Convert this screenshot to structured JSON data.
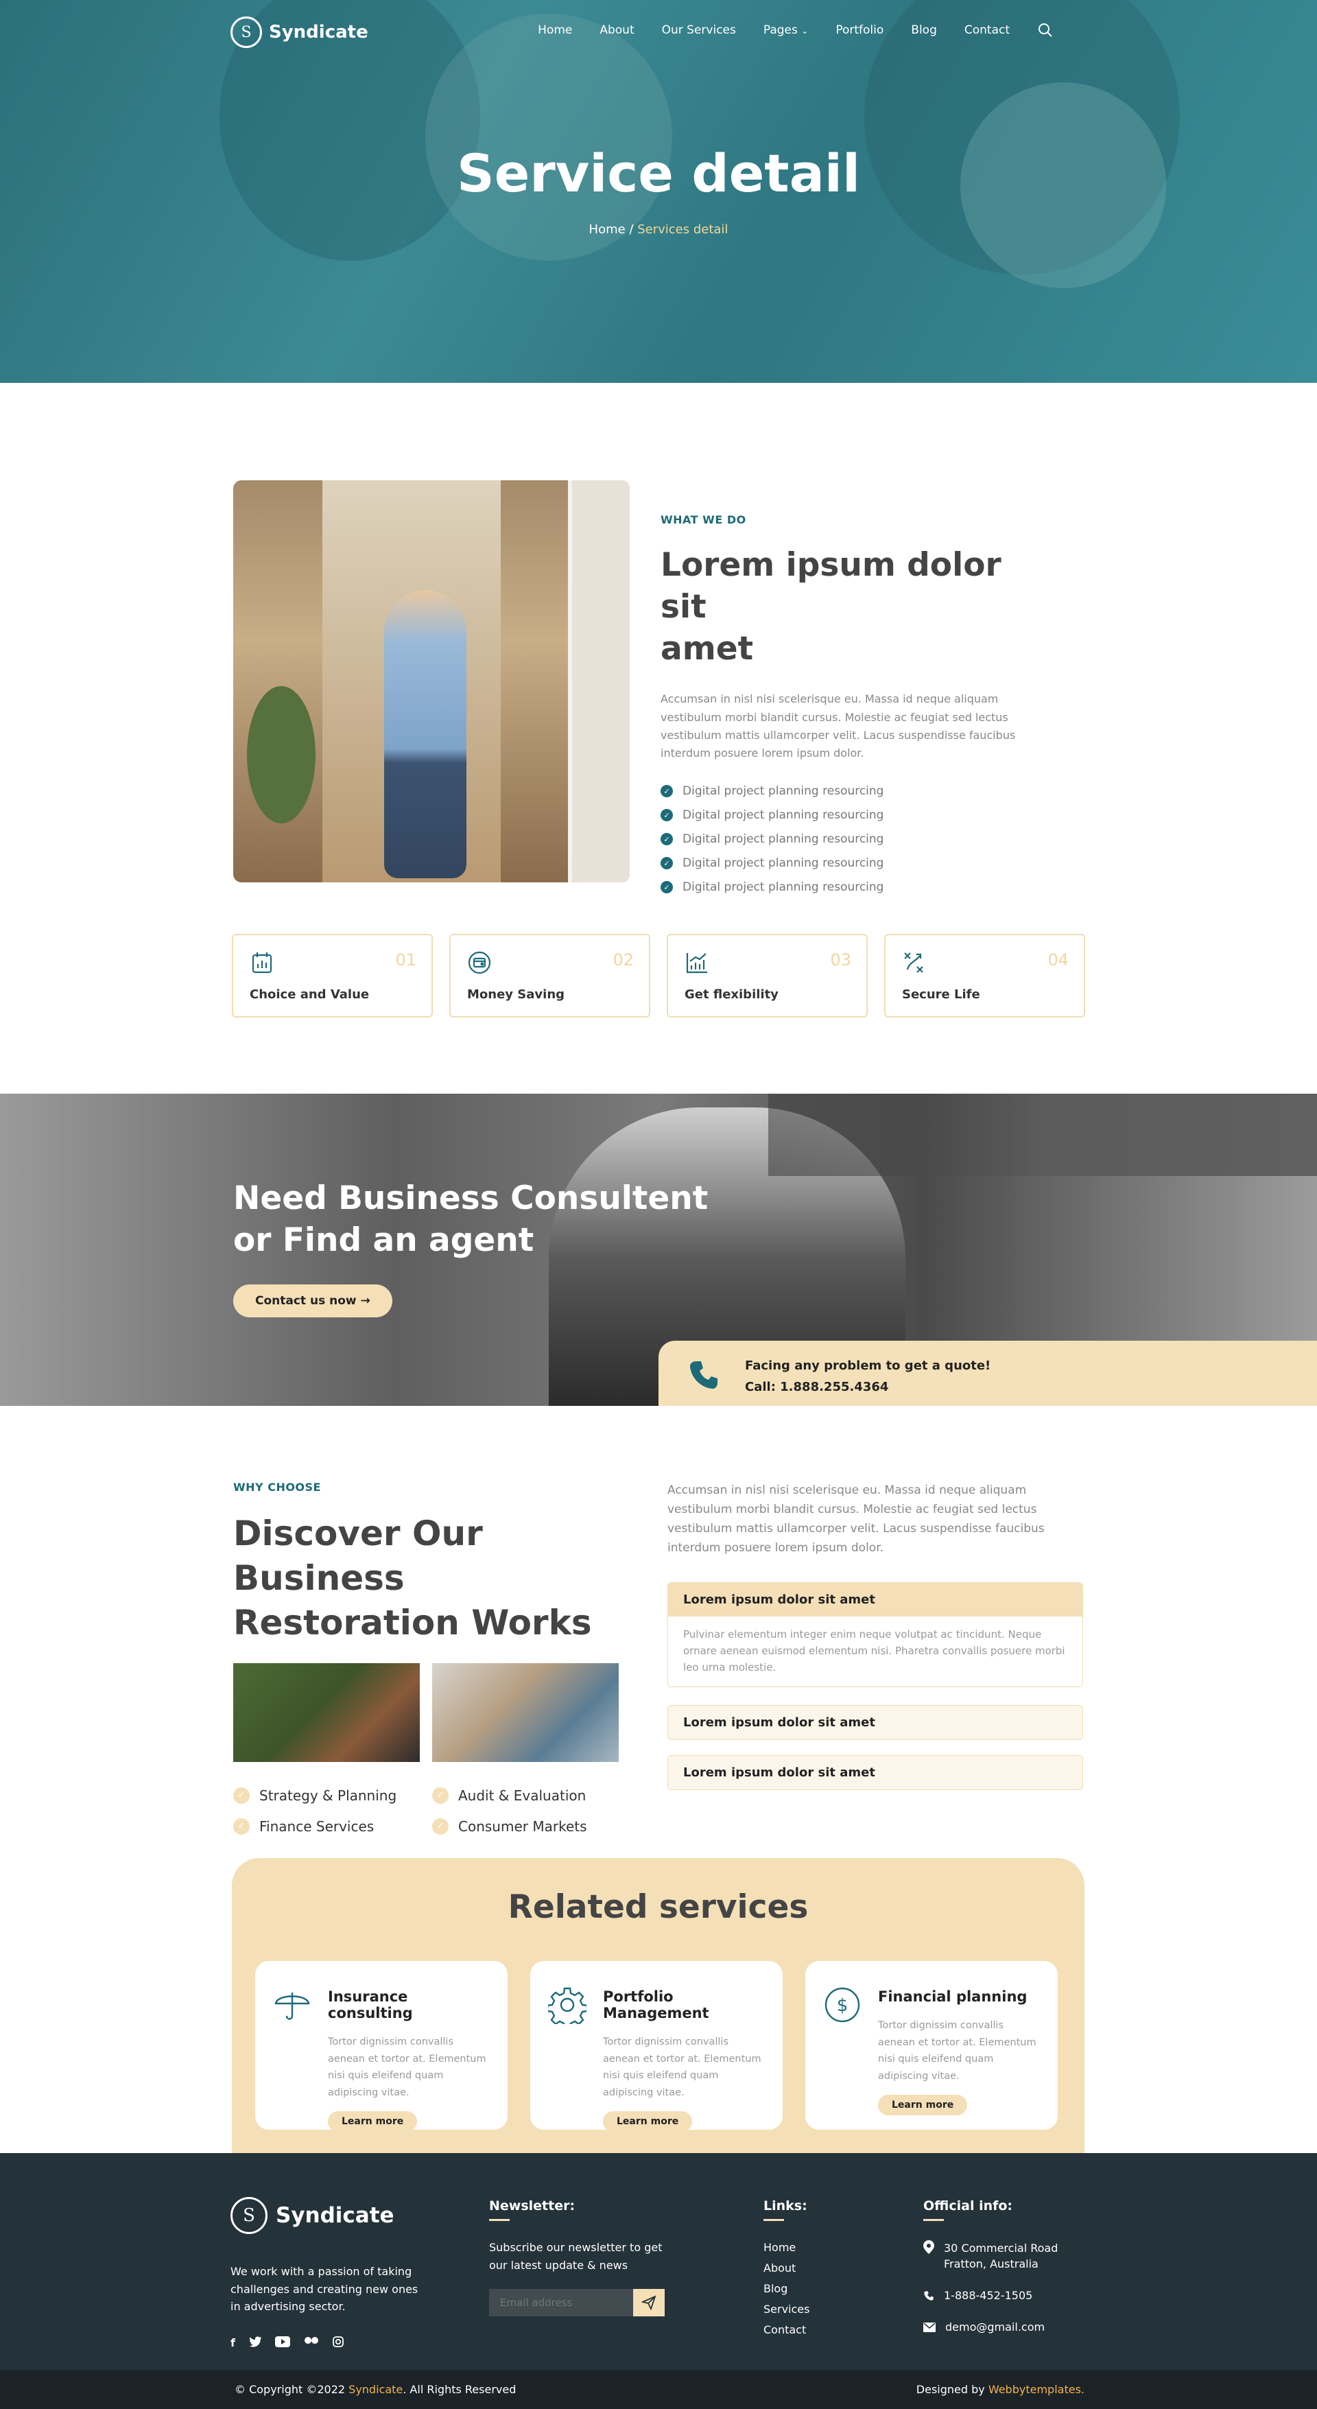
{
  "nav": {
    "brand": "Syndicate",
    "brand_mark": "S",
    "items": [
      "Home",
      "About",
      "Our Services",
      "Pages",
      "Portfolio",
      "Blog",
      "Contact"
    ],
    "pages_caret": "⌄"
  },
  "hero": {
    "title": "Service detail",
    "crumb_home": "Home",
    "crumb_sep": " / ",
    "crumb_current": "Services detail"
  },
  "about": {
    "eyebrow": "WHAT WE DO",
    "heading_l1": "Lorem ipsum dolor sit",
    "heading_l2": "amet",
    "para": "Accumsan in nisl nisi scelerisque eu. Massa id neque aliquam vestibulum morbi blandit cursus. Molestie ac feugiat sed lectus vestibulum mattis ullamcorper velit. Lacus suspendisse faucibus interdum posuere lorem ipsum dolor.",
    "checks": [
      "Digital project planning resourcing",
      "Digital project planning resourcing",
      "Digital project planning resourcing",
      "Digital project planning resourcing",
      "Digital project planning resourcing"
    ]
  },
  "features": [
    {
      "num": "01",
      "label": "Choice and Value",
      "icon": "calendar-chart-icon"
    },
    {
      "num": "02",
      "label": "Money Saving",
      "icon": "wallet-icon"
    },
    {
      "num": "03",
      "label": "Get flexibility",
      "icon": "growth-chart-icon"
    },
    {
      "num": "04",
      "label": "Secure Life",
      "icon": "strategy-icon"
    }
  ],
  "banner": {
    "heading_l1": "Need Business Consultent",
    "heading_l2": "or Find an agent",
    "cta": "Contact us now",
    "cta_arrow": "→",
    "quote_line1": "Facing any problem to get a quote!",
    "quote_line2": "Call: 1.888.255.4364"
  },
  "why": {
    "eyebrow": "WHY CHOOSE",
    "heading_l1": "Discover Our Business",
    "heading_l2": "Restoration Works",
    "services": [
      "Strategy & Planning",
      "Audit & Evaluation",
      "Finance Services",
      "Consumer Markets"
    ],
    "para": "Accumsan in nisl nisi scelerisque eu. Massa id neque aliquam vestibulum morbi blandit cursus. Molestie ac feugiat sed lectus vestibulum mattis ullamcorper velit. Lacus suspendisse faucibus interdum posuere lorem ipsum dolor.",
    "accordion": [
      {
        "title": "Lorem ipsum dolor sit amet",
        "body": "Pulvinar elementum integer enim neque volutpat ac tincidunt. Neque ornare aenean euismod elementum nisi. Pharetra convallis posuere morbi leo urna molestie."
      },
      {
        "title": "Lorem ipsum dolor sit amet"
      },
      {
        "title": "Lorem ipsum dolor sit amet"
      }
    ]
  },
  "related": {
    "heading": "Related services",
    "cards": [
      {
        "title": "Insurance consulting",
        "text": "Tortor dignissim convallis aenean et tortor at. Elementum nisi quis eleifend quam adipiscing vitae.",
        "cta": "Learn more",
        "icon": "umbrella-icon"
      },
      {
        "title": "Portfolio Management",
        "text": "Tortor dignissim convallis aenean et tortor at. Elementum nisi quis eleifend quam adipiscing vitae.",
        "cta": "Learn more",
        "icon": "gear-icon"
      },
      {
        "title": "Financial planning",
        "text": "Tortor dignissim convallis aenean et tortor at. Elementum nisi quis eleifend quam adipiscing vitae.",
        "cta": "Learn more",
        "icon": "dollar-icon"
      }
    ]
  },
  "footer": {
    "brand": "Syndicate",
    "about": "We work with a passion of taking challenges and creating new ones in advertising sector.",
    "newsletter_title": "Newsletter:",
    "newsletter_text": "Subscribe our newsletter to get our latest update & news",
    "email_placeholder": "Email address",
    "links_title": "Links:",
    "links": [
      "Home",
      "About",
      "Blog",
      "Services",
      "Contact"
    ],
    "info_title": "Official info:",
    "address_l1": "30 Commercial Road",
    "address_l2": "Fratton, Australia",
    "phone": "1-888-452-1505",
    "email": "demo@gmail.com",
    "social": [
      "facebook-icon",
      "twitter-icon",
      "youtube-icon",
      "flickr-icon",
      "instagram-icon"
    ]
  },
  "copyright": {
    "prefix": "© Copyright ©2022 ",
    "brand": "Syndicate",
    "suffix": ". All Rights Reserved",
    "designed_prefix": "Designed by ",
    "designer": "Webbytemplates",
    "designed_suffix": "."
  },
  "colors": {
    "teal": "#1d6a78",
    "cream": "#f4dfb7",
    "footer_bg": "#243239",
    "copyright_bg": "#1b2328",
    "highlight": "#f4b24a"
  }
}
